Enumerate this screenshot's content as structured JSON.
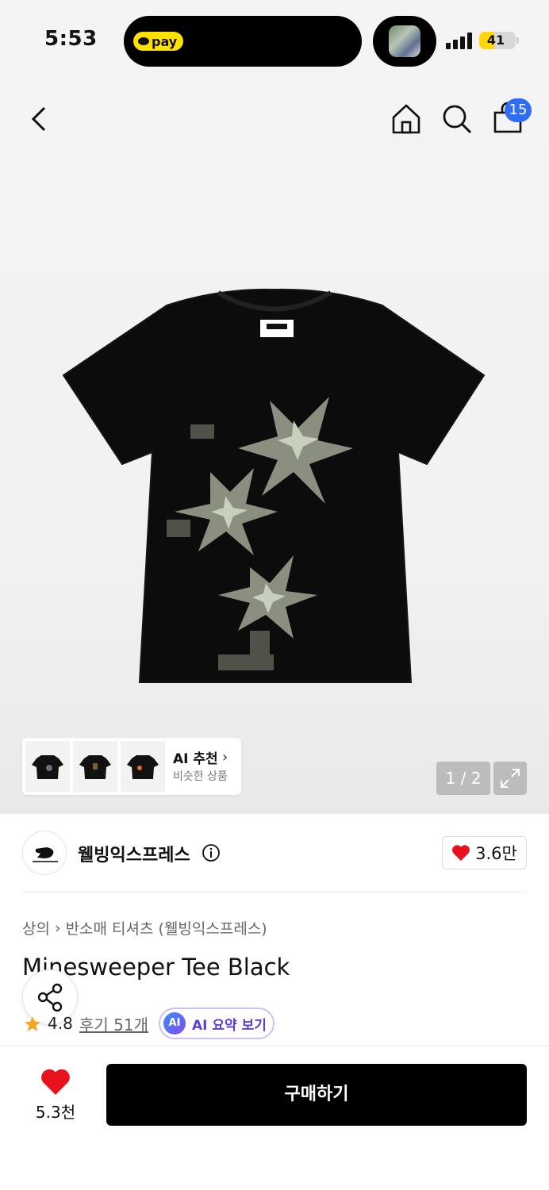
{
  "status_bar": {
    "time": "5:53",
    "pay_label": "pay",
    "battery_level": "41",
    "battery_fraction": 0.41,
    "signal_bars": 4
  },
  "nav": {
    "cart_count": "15",
    "icons": [
      "back-icon",
      "home-icon",
      "search-icon",
      "shopping-bag-icon"
    ]
  },
  "gallery": {
    "ai_recommend": {
      "title": "AI 추천",
      "subtitle": "비슷한 상품"
    },
    "page_indicator": "1 / 2"
  },
  "brand": {
    "name": "웰빙익스프레스",
    "likes": "3.6만"
  },
  "product": {
    "breadcrumb": [
      "상의",
      "반소매 티셔츠 (웰빙익스프레스)"
    ],
    "title": "Minesweeper Tee Black",
    "rating": "4.8",
    "reviews": "후기 51개",
    "ai_summary_badge": "AI",
    "ai_summary": "AI 요약 보기"
  },
  "bottom_bar": {
    "likes": "5.3천",
    "buy_label": "구매하기"
  },
  "colors": {
    "accent_blue": "#2f6df6",
    "heart_red": "#e8121d",
    "star_orange": "#f5a623",
    "ai_purple": "#5b3fd6"
  }
}
